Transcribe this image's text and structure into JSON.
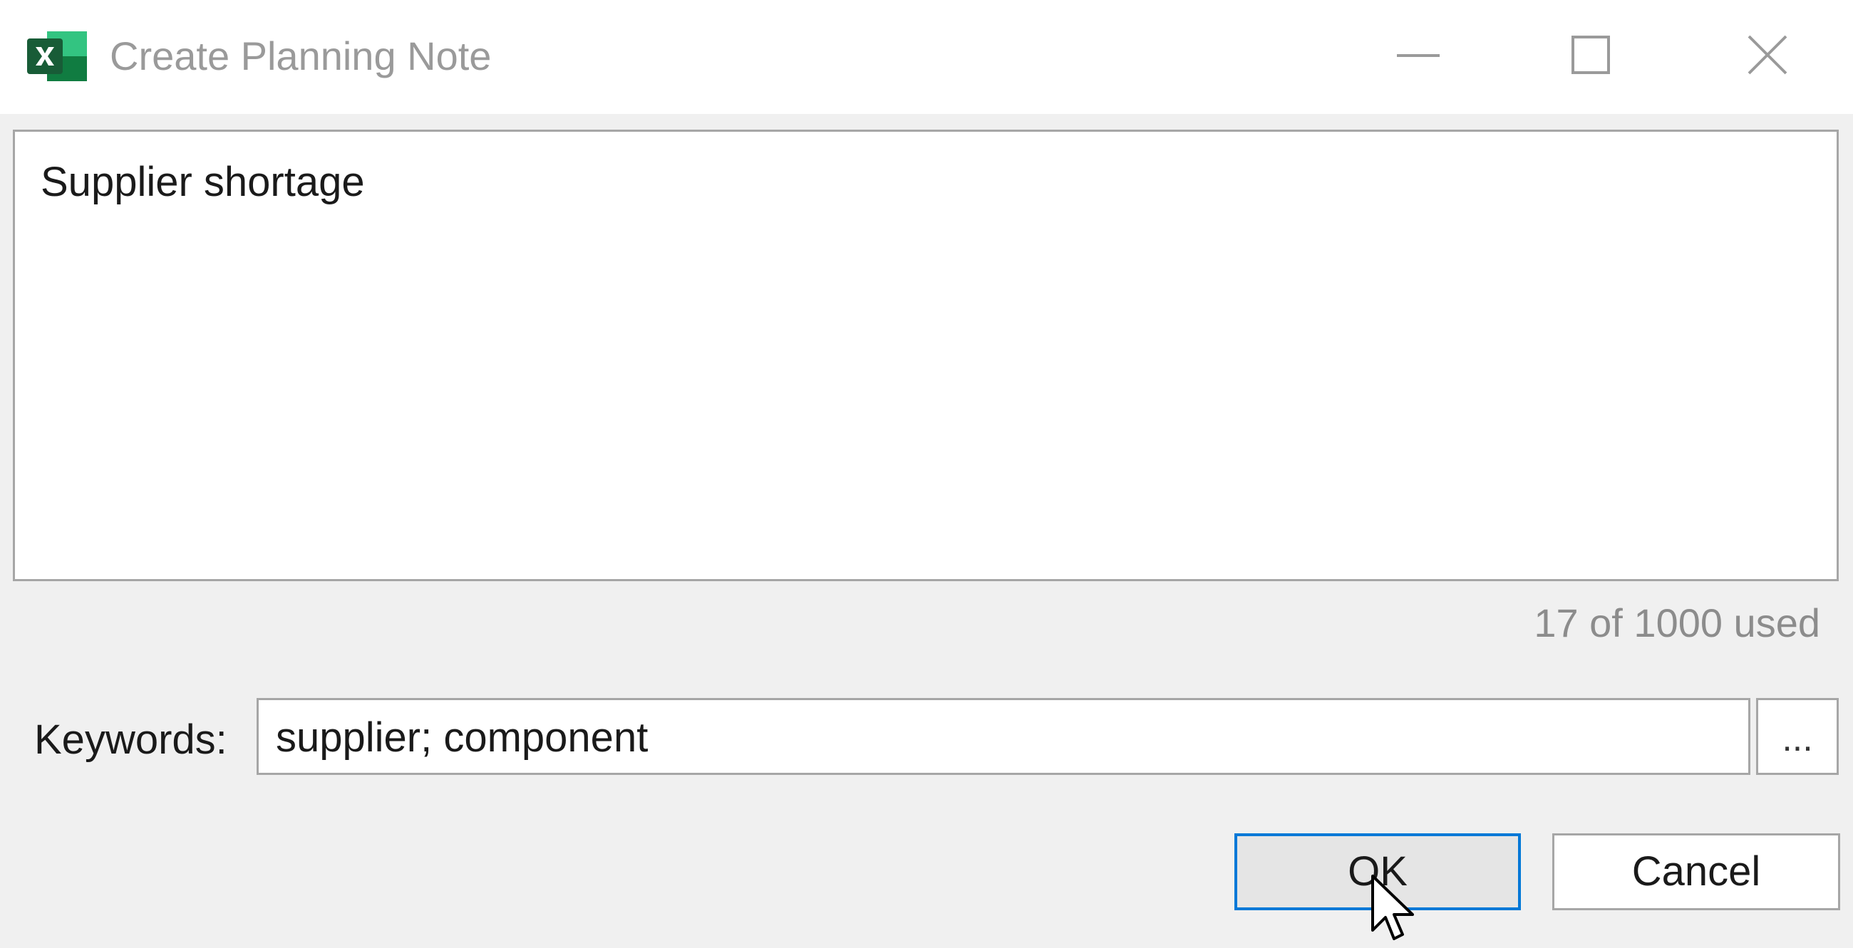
{
  "window": {
    "title": "Create Planning Note",
    "app_icon": "excel-icon",
    "controls": {
      "minimize_icon": "minimize-icon",
      "maximize_icon": "maximize-icon",
      "close_icon": "close-icon"
    }
  },
  "note": {
    "text": "Supplier shortage",
    "counter": "17 of 1000 used"
  },
  "keywords": {
    "label": "Keywords:",
    "value": "supplier; component",
    "browse_label": "..."
  },
  "buttons": {
    "ok": "OK",
    "cancel": "Cancel"
  },
  "colors": {
    "excel_green": "#1d6f42",
    "focus_border": "#0078d7"
  }
}
